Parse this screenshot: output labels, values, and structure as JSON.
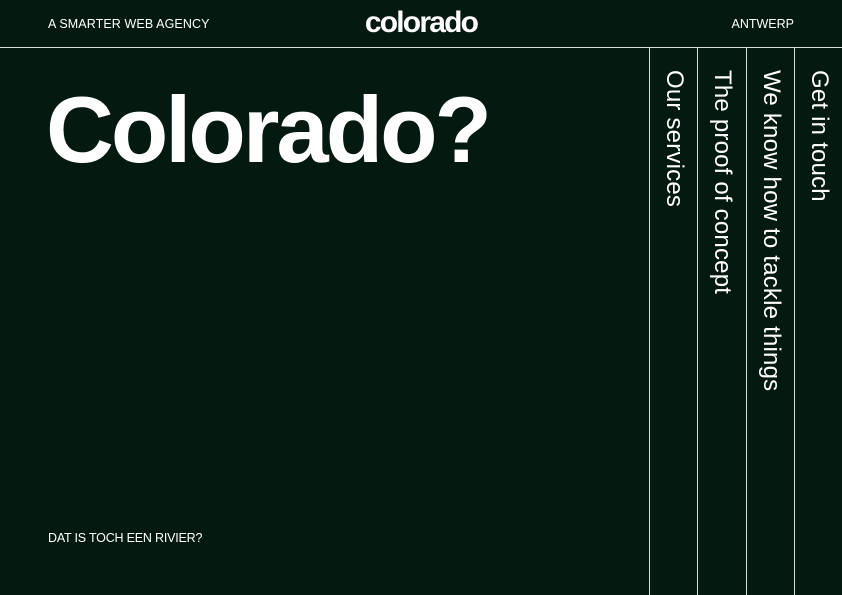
{
  "header": {
    "tagline": "A SMARTER WEB AGENCY",
    "logo": "colorado",
    "city": "ANTWERP"
  },
  "hero": {
    "title": "Colorado?",
    "subtitle": "DAT IS TOCH EEN RIVIER?"
  },
  "nav": [
    {
      "label": "Our services"
    },
    {
      "label": "The proof of concept"
    },
    {
      "label": "We know how to tackle things"
    },
    {
      "label": "Get in touch"
    }
  ],
  "colors": {
    "background": "#04190f",
    "text": "#ffffff",
    "divider": "#d8ddd9"
  }
}
